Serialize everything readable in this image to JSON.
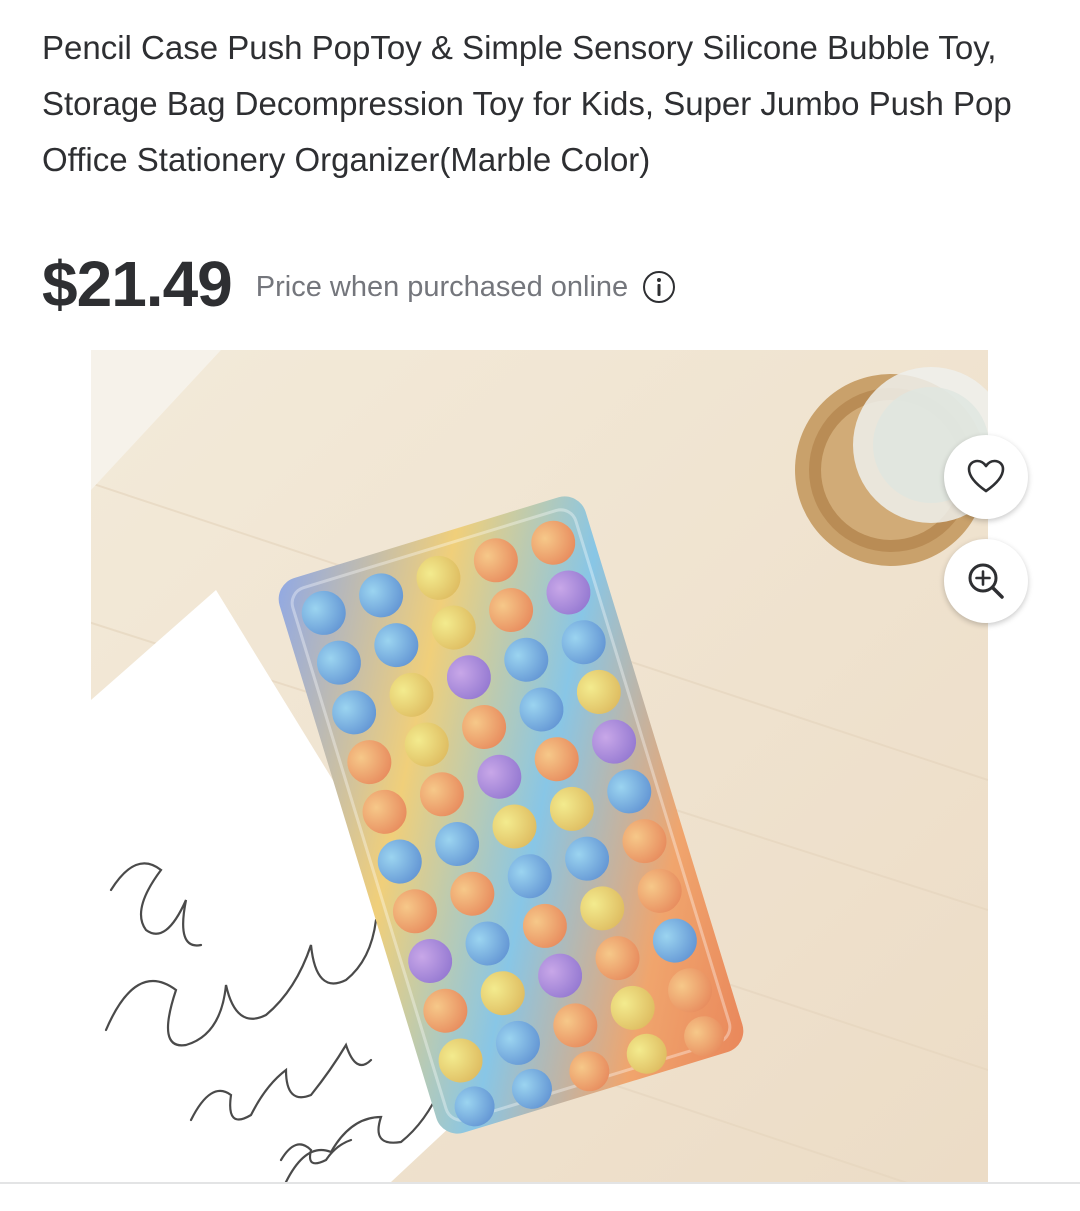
{
  "product": {
    "title": "Pencil Case Push PopToy & Simple Sensory Silicone Bubble Toy, Storage Bag Decompression Toy for Kids, Super Jumbo Push Pop Office Stationery Organizer(Marble Color)",
    "price": "$21.49",
    "price_note": "Price when purchased online",
    "image_handwriting": "...ce romance photographs by ...thy Rya..."
  },
  "icons": {
    "info": "info-circle-icon",
    "favorite": "heart-outline-icon",
    "zoom": "zoom-in-icon"
  },
  "colors": {
    "text_primary": "#2e2f32",
    "text_secondary": "#74767c"
  }
}
